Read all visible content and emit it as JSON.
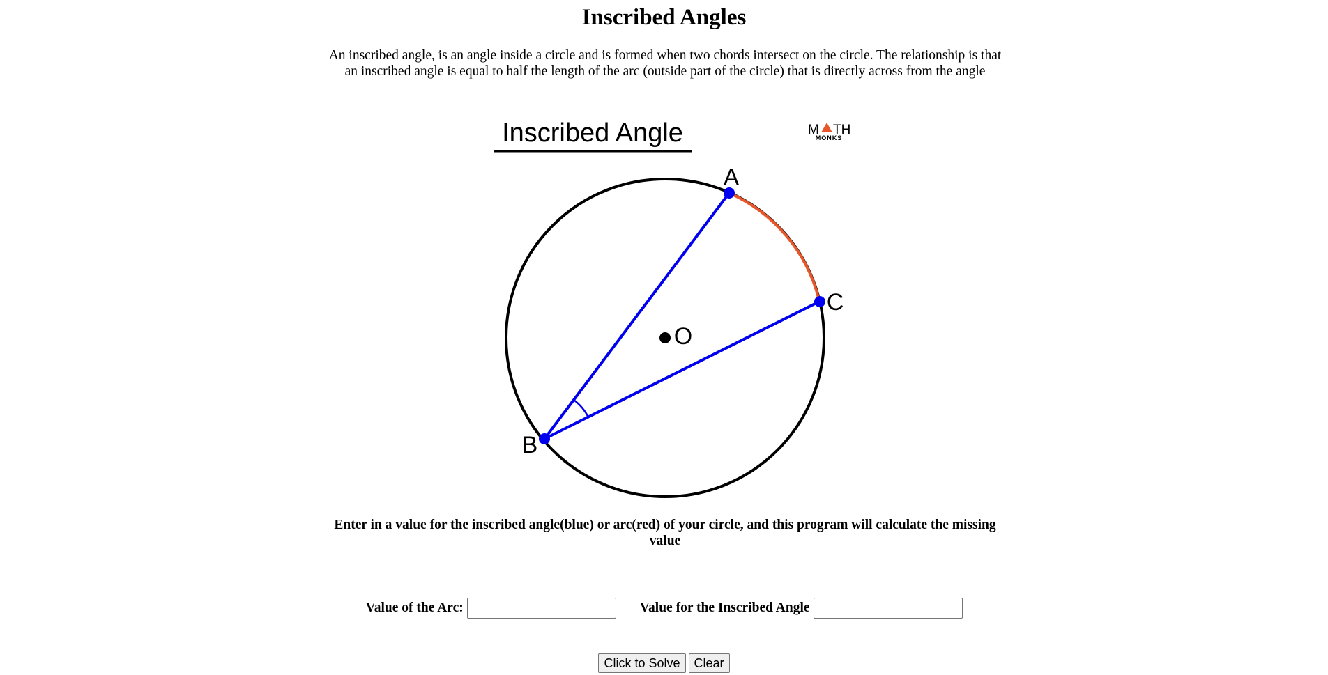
{
  "page": {
    "title": "Inscribed Angles",
    "intro": "An inscribed angle, is an angle inside a circle and is formed when two chords intersect on the circle. The relationship is that an inscribed angle is equal to half the length of the arc (outside part of the circle) that is directly across from the angle"
  },
  "figure": {
    "heading": "Inscribed Angle",
    "logo_line1_left": "M",
    "logo_line1_right": "TH",
    "logo_line2": "MONKS",
    "point_labels": {
      "a": "A",
      "b": "B",
      "c": "C",
      "o": "O"
    },
    "colors": {
      "chord": "#0000ee",
      "arc": "#e8572a",
      "circle": "#000000",
      "logo_accent": "#e8572a"
    }
  },
  "instructions": "Enter in a value for the inscribed angle(blue) or arc(red) of your circle, and this program will calculate the missing value",
  "form": {
    "arc_label": "Value of the Arc:",
    "arc_value": "",
    "angle_label": "Value for the Inscribed Angle",
    "angle_value": "",
    "solve_button": "Click to Solve",
    "clear_button": "Clear"
  }
}
